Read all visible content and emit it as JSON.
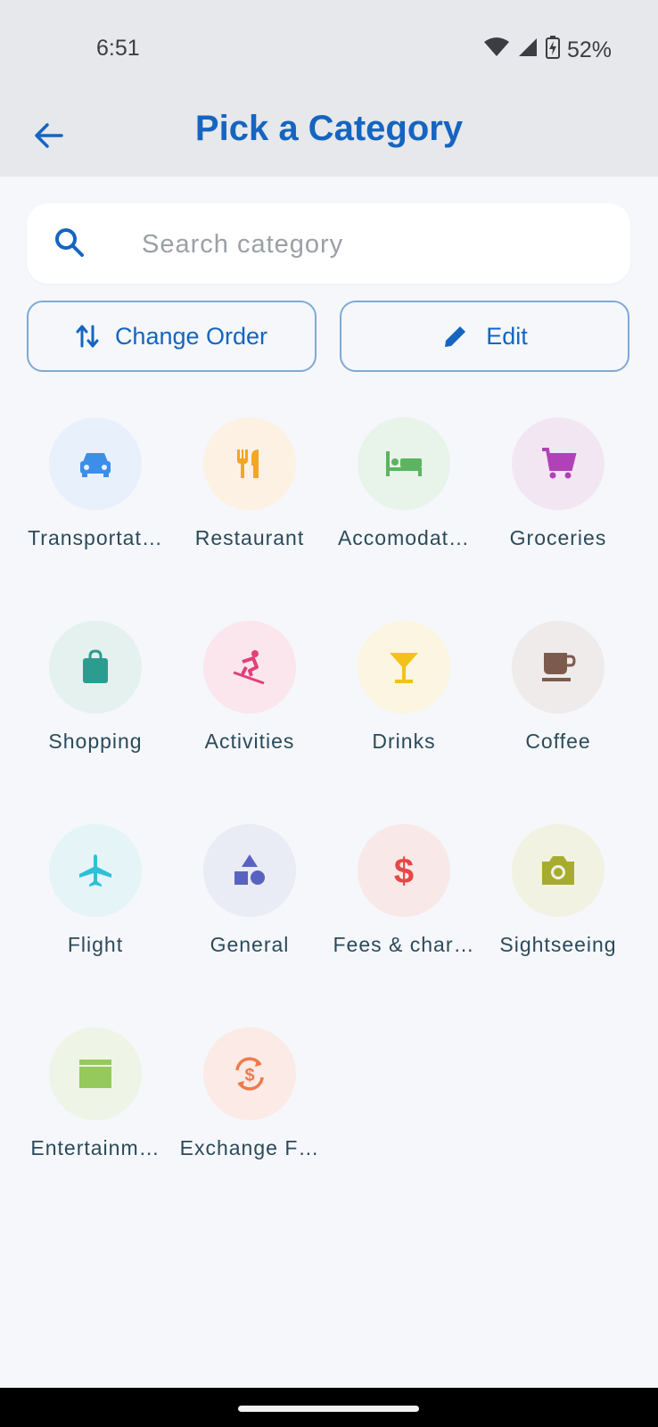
{
  "status": {
    "time": "6:51",
    "battery": "52%"
  },
  "header": {
    "title": "Pick a Category"
  },
  "search": {
    "placeholder": "Search category",
    "value": ""
  },
  "actions": {
    "change_order": "Change Order",
    "edit": "Edit"
  },
  "categories": [
    {
      "label": "Transportat…",
      "icon": "car-icon",
      "bg": "#e8f1fb",
      "fg": "#3d8ee8"
    },
    {
      "label": "Restaurant",
      "icon": "fork-knife-icon",
      "bg": "#fdf1e3",
      "fg": "#f5a524"
    },
    {
      "label": "Accomodat…",
      "icon": "bed-icon",
      "bg": "#e8f3ea",
      "fg": "#5cb460"
    },
    {
      "label": "Groceries",
      "icon": "cart-icon",
      "bg": "#f3e6f3",
      "fg": "#b042b8"
    },
    {
      "label": "Shopping",
      "icon": "shopping-bag-icon",
      "bg": "#e4f1ef",
      "fg": "#2a9d8f"
    },
    {
      "label": "Activities",
      "icon": "skiing-icon",
      "bg": "#fae6ec",
      "fg": "#e2407a"
    },
    {
      "label": "Drinks",
      "icon": "cocktail-icon",
      "bg": "#fbf5e1",
      "fg": "#f3c21a"
    },
    {
      "label": "Coffee",
      "icon": "coffee-cup-icon",
      "bg": "#eeebea",
      "fg": "#7d5a4e"
    },
    {
      "label": "Flight",
      "icon": "airplane-icon",
      "bg": "#e4f4f7",
      "fg": "#2fbfd8"
    },
    {
      "label": "General",
      "icon": "shapes-icon",
      "bg": "#e9ebf5",
      "fg": "#5a62c0"
    },
    {
      "label": "Fees & char…",
      "icon": "dollar-icon",
      "bg": "#f9e8e8",
      "fg": "#e54848"
    },
    {
      "label": "Sightseeing",
      "icon": "camera-icon",
      "bg": "#f1f2e2",
      "fg": "#a8ac2e"
    },
    {
      "label": "Entertainm…",
      "icon": "clapperboard-icon",
      "bg": "#eef4e6",
      "fg": "#96c95c"
    },
    {
      "label": "Exchange F…",
      "icon": "currency-exchange-icon",
      "bg": "#fbeae6",
      "fg": "#f07a4c"
    }
  ],
  "colors": {
    "accent": "#1565c0",
    "outline": "#7fa9d6",
    "label": "#2b4a5a"
  }
}
